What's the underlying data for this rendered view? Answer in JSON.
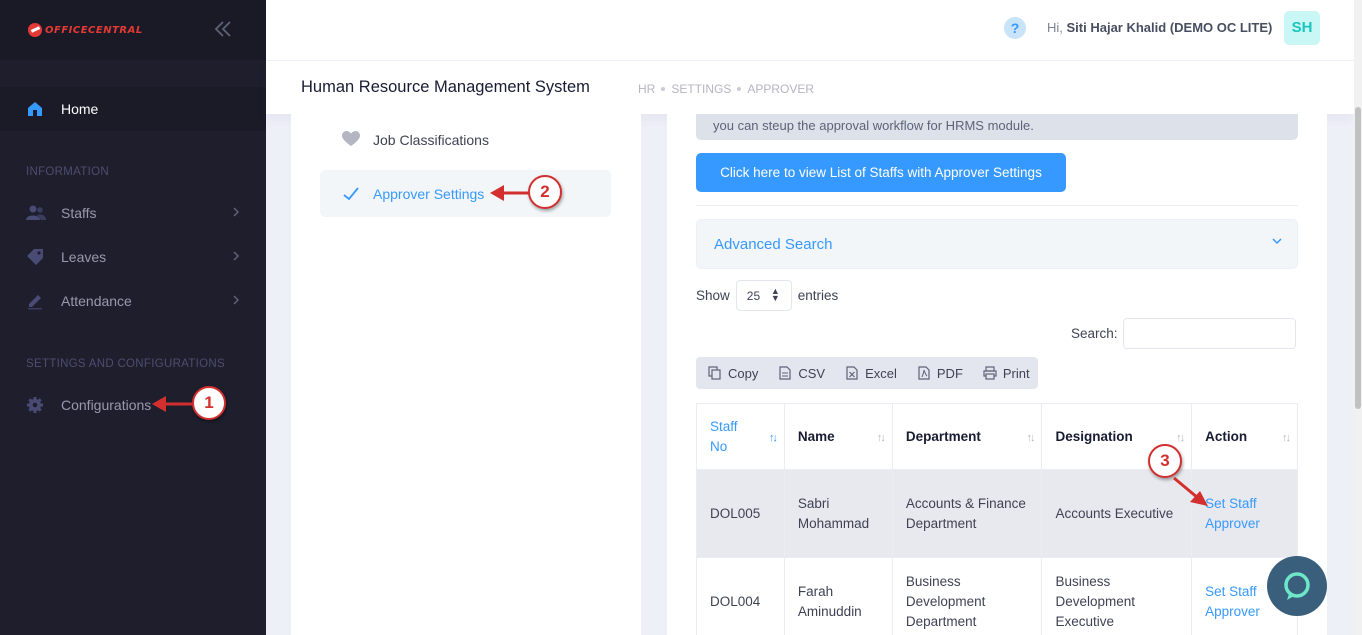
{
  "brand": {
    "logo_text": "OfficeCentral"
  },
  "sidebar": {
    "home_label": "Home",
    "sections": {
      "information": "INFORMATION",
      "settings": "SETTINGS AND CONFIGURATIONS"
    },
    "items": [
      {
        "label": "Staffs",
        "icon": "users-icon"
      },
      {
        "label": "Leaves",
        "icon": "tag-icon"
      },
      {
        "label": "Attendance",
        "icon": "pencil-icon"
      },
      {
        "label": "Configurations",
        "icon": "gear-icon"
      }
    ]
  },
  "header": {
    "help": "?",
    "greeting_prefix": "Hi,",
    "user_name": "Siti Hajar Khalid (DEMO OC LITE)",
    "avatar_initials": "SH"
  },
  "subheader": {
    "title": "Human Resource Management System",
    "breadcrumbs": [
      "HR",
      "SETTINGS",
      "APPROVER"
    ]
  },
  "settings_menu": [
    {
      "label": "Job Classifications",
      "icon": "heart-icon"
    },
    {
      "label": "Approver Settings",
      "icon": "check-icon",
      "active": true
    }
  ],
  "main": {
    "info_note": "you can steup the approval workflow for HRMS module.",
    "list_button": "Click here to view List of Staffs with Approver Settings",
    "advanced_search": "Advanced Search",
    "show_label": "Show",
    "entries_value": "25",
    "entries_label": "entries",
    "search_label": "Search:",
    "export_buttons": [
      "Copy",
      "CSV",
      "Excel",
      "PDF",
      "Print"
    ],
    "table": {
      "columns": [
        "Staff No",
        "Name",
        "Department",
        "Designation",
        "Action"
      ],
      "rows": [
        {
          "staff_no": "DOL005",
          "name": "Sabri Mohammad",
          "department": "Accounts & Finance Department",
          "designation": "Accounts Executive",
          "action": "Set Staff Approver"
        },
        {
          "staff_no": "DOL004",
          "name": "Farah Aminuddin",
          "department": "Business Development Department",
          "designation": "Business Development Executive",
          "action": "Set Staff Approver"
        }
      ]
    }
  },
  "annotations": [
    "1",
    "2",
    "3"
  ],
  "colors": {
    "accent": "#3699ff",
    "sidebar": "#1e1e2d",
    "annotation": "#d32f2f"
  }
}
